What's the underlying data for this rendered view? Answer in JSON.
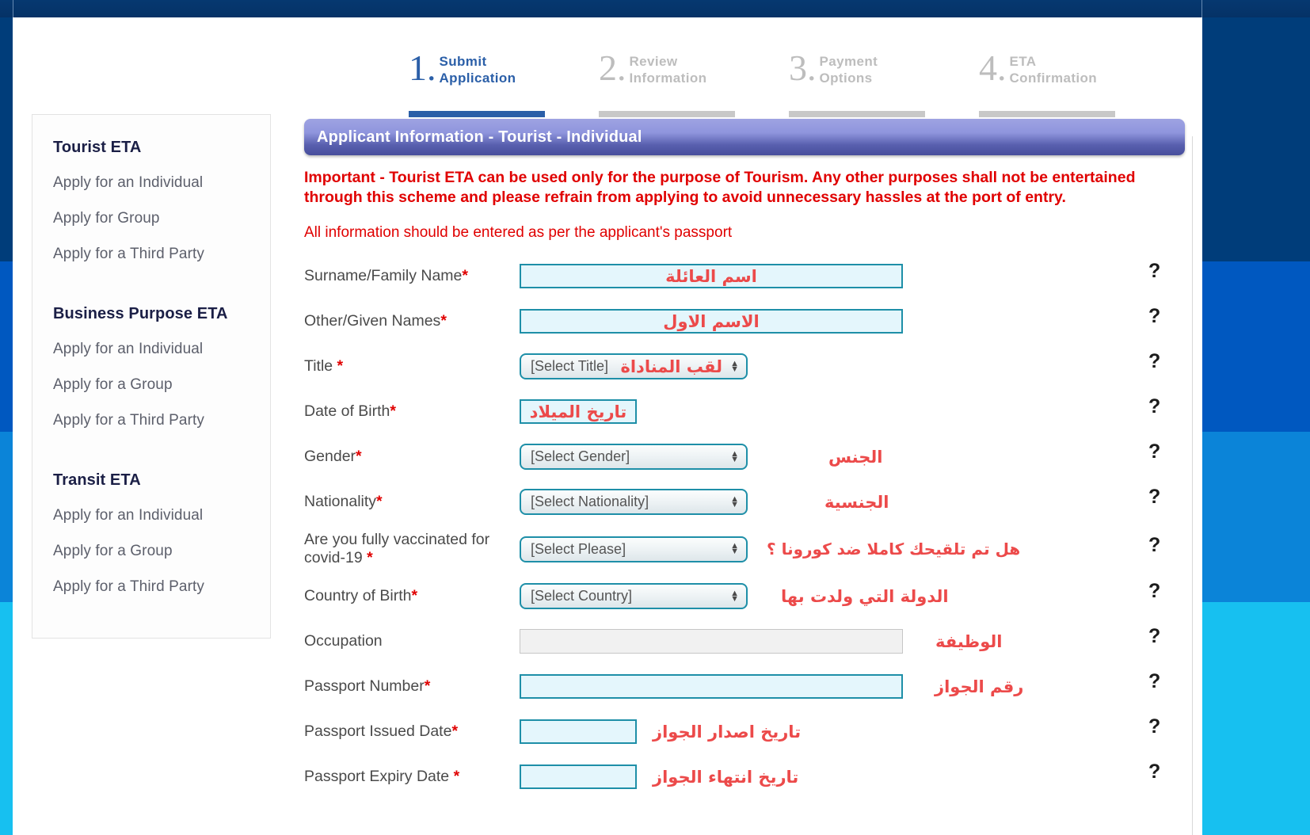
{
  "steps": [
    {
      "num": "1.",
      "line1": "Submit",
      "line2": "Application",
      "active": true
    },
    {
      "num": "2.",
      "line1": "Review",
      "line2": "Information",
      "active": false
    },
    {
      "num": "3.",
      "line1": "Payment",
      "line2": "Options",
      "active": false
    },
    {
      "num": "4.",
      "line1": "ETA",
      "line2": "Confirmation",
      "active": false
    }
  ],
  "sidebar": {
    "groups": [
      {
        "heading": "Tourist ETA",
        "items": [
          "Apply for an Individual",
          "Apply for Group",
          "Apply for a Third Party"
        ]
      },
      {
        "heading": "Business Purpose ETA",
        "items": [
          "Apply for an Individual",
          "Apply for a Group",
          "Apply for a Third Party"
        ]
      },
      {
        "heading": "Transit ETA",
        "items": [
          "Apply for an Individual",
          "Apply for a Group",
          "Apply for a Third Party"
        ]
      }
    ]
  },
  "panel": {
    "title": "Applicant Information - Tourist - Individual",
    "notice": "Important - Tourist ETA can be used only for the purpose of Tourism. Any other purposes shall not be entertained through this scheme and please refrain from applying to avoid unnecessary hassles at the port of entry.",
    "subnotice": "All information should be entered as per the applicant's passport"
  },
  "form": {
    "surname": {
      "label": "Surname/Family Name",
      "required": true,
      "value": "",
      "arabic": "اسم العائلة"
    },
    "given_names": {
      "label": "Other/Given Names",
      "required": true,
      "value": "",
      "arabic": "الاسم الاول"
    },
    "title": {
      "label": "Title ",
      "required": true,
      "selected": "[Select Title]",
      "arabic": "لقب المناداة"
    },
    "dob": {
      "label": "Date of Birth",
      "required": true,
      "value": "",
      "arabic": "تاريخ الميلاد"
    },
    "gender": {
      "label": "Gender",
      "required": true,
      "selected": "[Select Gender]",
      "arabic": "الجنس"
    },
    "nationality": {
      "label": "Nationality",
      "required": true,
      "selected": "[Select Nationality]",
      "arabic": "الجنسية"
    },
    "vaccinated": {
      "label": "Are you fully vaccinated for covid-19 ",
      "required": true,
      "selected": "[Select Please]",
      "arabic": "هل تم تلقيحك كاملا ضد كورونا ؟"
    },
    "country_birth": {
      "label": "Country of Birth",
      "required": true,
      "selected": "[Select Country]",
      "arabic": "الدولة التي ولدت بها"
    },
    "occupation": {
      "label": "Occupation",
      "required": false,
      "value": "",
      "arabic": "الوظيفة"
    },
    "passport_no": {
      "label": "Passport Number",
      "required": true,
      "value": "",
      "arabic": "رقم الجواز"
    },
    "passport_issued": {
      "label": "Passport Issued Date",
      "required": true,
      "value": "",
      "arabic": "تاريخ اصدار الجواز"
    },
    "passport_expiry": {
      "label": "Passport Expiry Date ",
      "required": true,
      "value": "",
      "arabic": "تاريخ انتهاء الجواز"
    },
    "help_symbol": "?"
  },
  "colors": {
    "accent_blue": "#2b5fa8",
    "panel_purple": "#585fae",
    "notice_red": "#e00000",
    "arabic_red": "#ec4a4a",
    "field_border": "#1e8fa8",
    "field_fill": "#e4f6fc",
    "chrome_navy": "#053266"
  }
}
